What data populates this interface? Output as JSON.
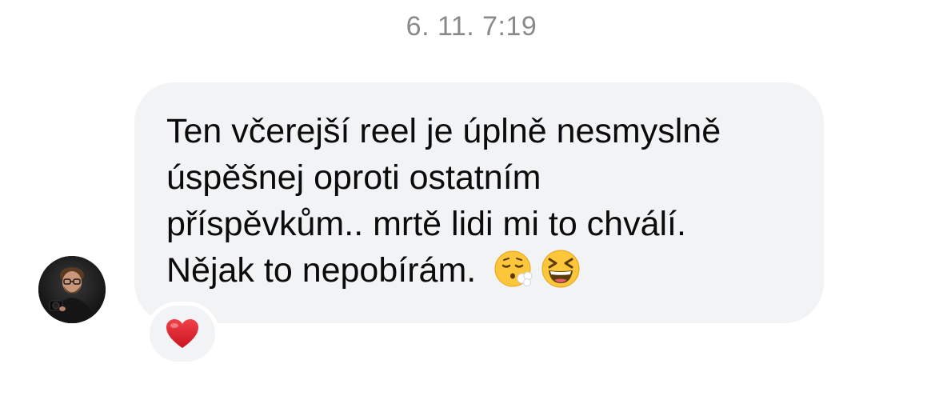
{
  "conversation": {
    "timestamp": "6. 11. 7:19"
  },
  "message": {
    "sender_avatar_icon": "profile-photo",
    "lines": [
      "Ten včerejší reel je úplně nesmyslně",
      "úspěšnej oproti ostatním",
      "příspěvkům.. mrtě lidi mi to chválí.",
      "Nějak to nepobírám."
    ],
    "trailing_emojis": [
      "face-exhaling-emoji",
      "grinning-squinting-face-emoji"
    ],
    "reaction": {
      "emoji": "red-heart-emoji",
      "color": "#e0242b"
    }
  },
  "colors": {
    "bubble_background": "#f2f3f5",
    "timestamp_text": "#8a8a8e",
    "message_text": "#0b0b0b"
  }
}
